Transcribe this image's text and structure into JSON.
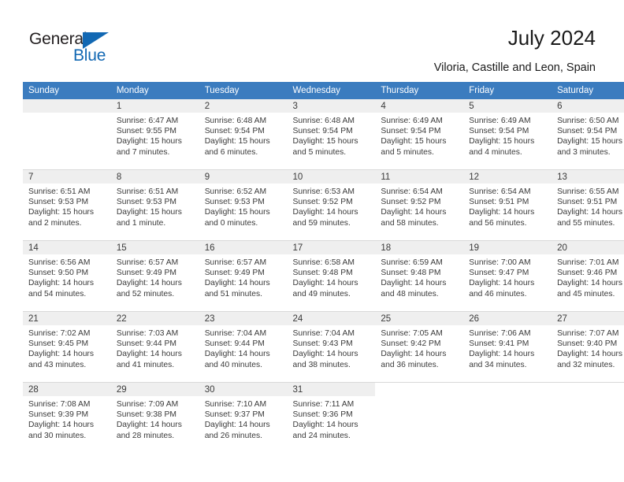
{
  "brand": {
    "word_one": "General",
    "word_two": "Blue",
    "triangle_color": "#1268b3",
    "text_color": "#231f20"
  },
  "header": {
    "title": "July 2024",
    "location": "Viloria, Castille and Leon, Spain"
  },
  "calendar": {
    "header_bg": "#3b7cbf",
    "header_text_color": "#ffffff",
    "daynum_bg": "#efefef",
    "weekdays": [
      "Sunday",
      "Monday",
      "Tuesday",
      "Wednesday",
      "Thursday",
      "Friday",
      "Saturday"
    ],
    "labels": {
      "sunrise": "Sunrise:",
      "sunset": "Sunset:",
      "daylight": "Daylight:"
    },
    "weeks": [
      [
        {
          "day": "",
          "empty": true
        },
        {
          "day": "1",
          "sunrise": "Sunrise: 6:47 AM",
          "sunset": "Sunset: 9:55 PM",
          "daylight_l1": "Daylight: 15 hours",
          "daylight_l2": "and 7 minutes."
        },
        {
          "day": "2",
          "sunrise": "Sunrise: 6:48 AM",
          "sunset": "Sunset: 9:54 PM",
          "daylight_l1": "Daylight: 15 hours",
          "daylight_l2": "and 6 minutes."
        },
        {
          "day": "3",
          "sunrise": "Sunrise: 6:48 AM",
          "sunset": "Sunset: 9:54 PM",
          "daylight_l1": "Daylight: 15 hours",
          "daylight_l2": "and 5 minutes."
        },
        {
          "day": "4",
          "sunrise": "Sunrise: 6:49 AM",
          "sunset": "Sunset: 9:54 PM",
          "daylight_l1": "Daylight: 15 hours",
          "daylight_l2": "and 5 minutes."
        },
        {
          "day": "5",
          "sunrise": "Sunrise: 6:49 AM",
          "sunset": "Sunset: 9:54 PM",
          "daylight_l1": "Daylight: 15 hours",
          "daylight_l2": "and 4 minutes."
        },
        {
          "day": "6",
          "sunrise": "Sunrise: 6:50 AM",
          "sunset": "Sunset: 9:54 PM",
          "daylight_l1": "Daylight: 15 hours",
          "daylight_l2": "and 3 minutes."
        }
      ],
      [
        {
          "day": "7",
          "sunrise": "Sunrise: 6:51 AM",
          "sunset": "Sunset: 9:53 PM",
          "daylight_l1": "Daylight: 15 hours",
          "daylight_l2": "and 2 minutes."
        },
        {
          "day": "8",
          "sunrise": "Sunrise: 6:51 AM",
          "sunset": "Sunset: 9:53 PM",
          "daylight_l1": "Daylight: 15 hours",
          "daylight_l2": "and 1 minute."
        },
        {
          "day": "9",
          "sunrise": "Sunrise: 6:52 AM",
          "sunset": "Sunset: 9:53 PM",
          "daylight_l1": "Daylight: 15 hours",
          "daylight_l2": "and 0 minutes."
        },
        {
          "day": "10",
          "sunrise": "Sunrise: 6:53 AM",
          "sunset": "Sunset: 9:52 PM",
          "daylight_l1": "Daylight: 14 hours",
          "daylight_l2": "and 59 minutes."
        },
        {
          "day": "11",
          "sunrise": "Sunrise: 6:54 AM",
          "sunset": "Sunset: 9:52 PM",
          "daylight_l1": "Daylight: 14 hours",
          "daylight_l2": "and 58 minutes."
        },
        {
          "day": "12",
          "sunrise": "Sunrise: 6:54 AM",
          "sunset": "Sunset: 9:51 PM",
          "daylight_l1": "Daylight: 14 hours",
          "daylight_l2": "and 56 minutes."
        },
        {
          "day": "13",
          "sunrise": "Sunrise: 6:55 AM",
          "sunset": "Sunset: 9:51 PM",
          "daylight_l1": "Daylight: 14 hours",
          "daylight_l2": "and 55 minutes."
        }
      ],
      [
        {
          "day": "14",
          "sunrise": "Sunrise: 6:56 AM",
          "sunset": "Sunset: 9:50 PM",
          "daylight_l1": "Daylight: 14 hours",
          "daylight_l2": "and 54 minutes."
        },
        {
          "day": "15",
          "sunrise": "Sunrise: 6:57 AM",
          "sunset": "Sunset: 9:49 PM",
          "daylight_l1": "Daylight: 14 hours",
          "daylight_l2": "and 52 minutes."
        },
        {
          "day": "16",
          "sunrise": "Sunrise: 6:57 AM",
          "sunset": "Sunset: 9:49 PM",
          "daylight_l1": "Daylight: 14 hours",
          "daylight_l2": "and 51 minutes."
        },
        {
          "day": "17",
          "sunrise": "Sunrise: 6:58 AM",
          "sunset": "Sunset: 9:48 PM",
          "daylight_l1": "Daylight: 14 hours",
          "daylight_l2": "and 49 minutes."
        },
        {
          "day": "18",
          "sunrise": "Sunrise: 6:59 AM",
          "sunset": "Sunset: 9:48 PM",
          "daylight_l1": "Daylight: 14 hours",
          "daylight_l2": "and 48 minutes."
        },
        {
          "day": "19",
          "sunrise": "Sunrise: 7:00 AM",
          "sunset": "Sunset: 9:47 PM",
          "daylight_l1": "Daylight: 14 hours",
          "daylight_l2": "and 46 minutes."
        },
        {
          "day": "20",
          "sunrise": "Sunrise: 7:01 AM",
          "sunset": "Sunset: 9:46 PM",
          "daylight_l1": "Daylight: 14 hours",
          "daylight_l2": "and 45 minutes."
        }
      ],
      [
        {
          "day": "21",
          "sunrise": "Sunrise: 7:02 AM",
          "sunset": "Sunset: 9:45 PM",
          "daylight_l1": "Daylight: 14 hours",
          "daylight_l2": "and 43 minutes."
        },
        {
          "day": "22",
          "sunrise": "Sunrise: 7:03 AM",
          "sunset": "Sunset: 9:44 PM",
          "daylight_l1": "Daylight: 14 hours",
          "daylight_l2": "and 41 minutes."
        },
        {
          "day": "23",
          "sunrise": "Sunrise: 7:04 AM",
          "sunset": "Sunset: 9:44 PM",
          "daylight_l1": "Daylight: 14 hours",
          "daylight_l2": "and 40 minutes."
        },
        {
          "day": "24",
          "sunrise": "Sunrise: 7:04 AM",
          "sunset": "Sunset: 9:43 PM",
          "daylight_l1": "Daylight: 14 hours",
          "daylight_l2": "and 38 minutes."
        },
        {
          "day": "25",
          "sunrise": "Sunrise: 7:05 AM",
          "sunset": "Sunset: 9:42 PM",
          "daylight_l1": "Daylight: 14 hours",
          "daylight_l2": "and 36 minutes."
        },
        {
          "day": "26",
          "sunrise": "Sunrise: 7:06 AM",
          "sunset": "Sunset: 9:41 PM",
          "daylight_l1": "Daylight: 14 hours",
          "daylight_l2": "and 34 minutes."
        },
        {
          "day": "27",
          "sunrise": "Sunrise: 7:07 AM",
          "sunset": "Sunset: 9:40 PM",
          "daylight_l1": "Daylight: 14 hours",
          "daylight_l2": "and 32 minutes."
        }
      ],
      [
        {
          "day": "28",
          "sunrise": "Sunrise: 7:08 AM",
          "sunset": "Sunset: 9:39 PM",
          "daylight_l1": "Daylight: 14 hours",
          "daylight_l2": "and 30 minutes."
        },
        {
          "day": "29",
          "sunrise": "Sunrise: 7:09 AM",
          "sunset": "Sunset: 9:38 PM",
          "daylight_l1": "Daylight: 14 hours",
          "daylight_l2": "and 28 minutes."
        },
        {
          "day": "30",
          "sunrise": "Sunrise: 7:10 AM",
          "sunset": "Sunset: 9:37 PM",
          "daylight_l1": "Daylight: 14 hours",
          "daylight_l2": "and 26 minutes."
        },
        {
          "day": "31",
          "sunrise": "Sunrise: 7:11 AM",
          "sunset": "Sunset: 9:36 PM",
          "daylight_l1": "Daylight: 14 hours",
          "daylight_l2": "and 24 minutes."
        },
        {
          "day": "",
          "blank": true
        },
        {
          "day": "",
          "blank": true
        },
        {
          "day": "",
          "blank": true
        }
      ]
    ]
  }
}
